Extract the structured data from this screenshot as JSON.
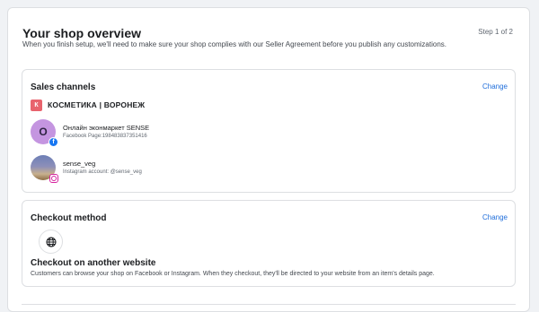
{
  "header": {
    "title": "Your shop overview",
    "subtitle": "When you finish setup, we'll need to make sure your shop complies with our Seller Agreement before you publish any customizations.",
    "step": "Step 1 of 2"
  },
  "sales_channels": {
    "title": "Sales channels",
    "change_label": "Change",
    "shop": {
      "badge": "К",
      "name": "КОСМЕТИКА | ВОРОНЕЖ"
    },
    "accounts": [
      {
        "avatar_letter": "О",
        "name": "Онлайн эконмаркет SENSE",
        "meta": "Facebook Page:198483837351416",
        "platform_icon": "facebook-icon"
      },
      {
        "name": "sense_veg",
        "meta": "Instagram account: @sense_veg",
        "platform_icon": "instagram-icon"
      }
    ]
  },
  "checkout": {
    "title": "Checkout method",
    "change_label": "Change",
    "icon": "globe-icon",
    "option_title": "Checkout on another website",
    "option_desc": "Customers can browse your shop on Facebook or Instagram. When they checkout, they'll be directed to your website from an item's details page."
  },
  "colors": {
    "link": "#216fdb",
    "facebook": "#1877f2",
    "shop_badge": "#e8636d"
  }
}
